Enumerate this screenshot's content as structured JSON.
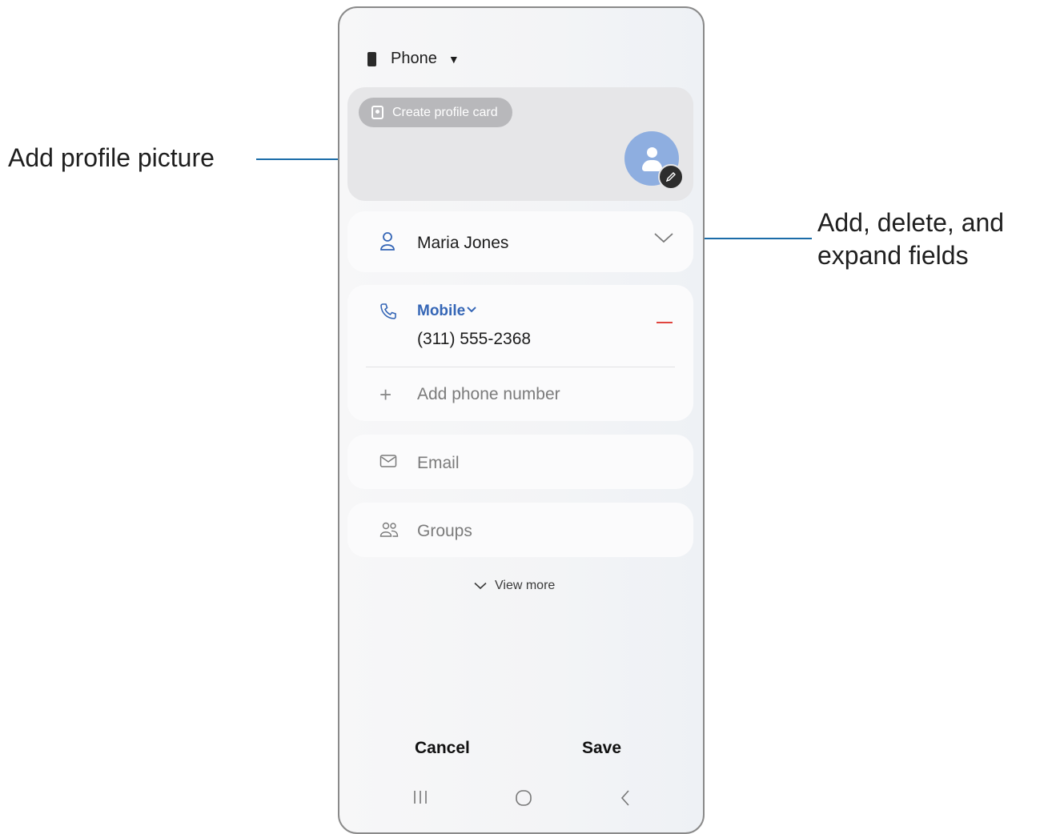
{
  "callouts": {
    "profile_picture": "Add profile picture",
    "fields_line1": "Add, delete, and",
    "fields_line2": "expand fields"
  },
  "storage": {
    "label": "Phone",
    "icon": "phone-device-icon"
  },
  "profile": {
    "create_card_label": "Create profile card"
  },
  "name_field": {
    "value": "Maria Jones"
  },
  "phone_field": {
    "type_label": "Mobile",
    "number": "(311) 555-2368",
    "add_label": "Add phone number"
  },
  "email_field": {
    "placeholder": "Email"
  },
  "groups_field": {
    "placeholder": "Groups"
  },
  "view_more": "View more",
  "actions": {
    "cancel": "Cancel",
    "save": "Save"
  },
  "colors": {
    "accent_blue": "#3566b6",
    "callout_line": "#1b6ca8",
    "remove_red": "#e0453f"
  }
}
